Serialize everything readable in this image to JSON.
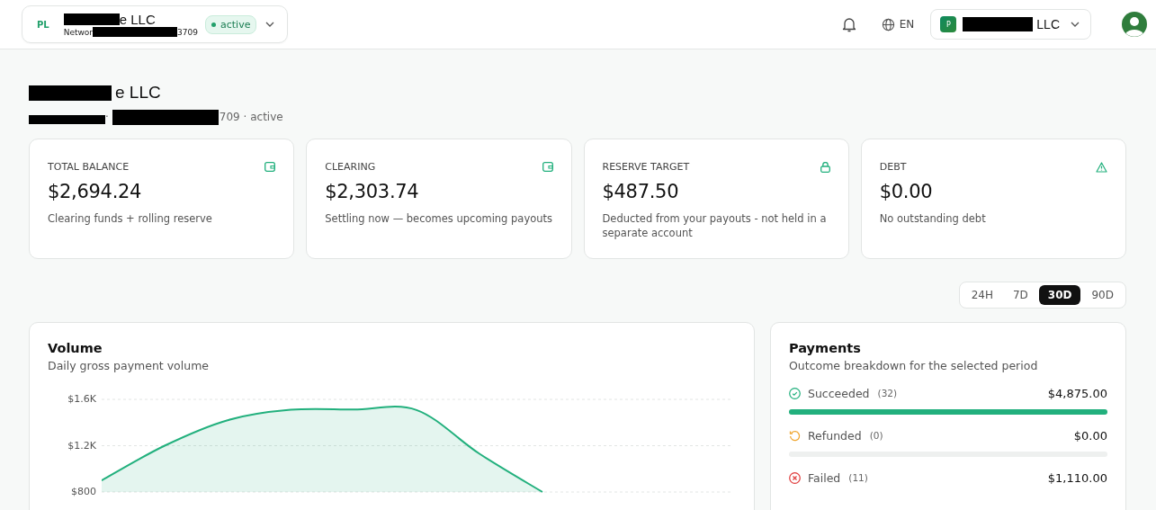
{
  "header": {
    "account_switcher": {
      "initials": "PL",
      "name": [
        {
          "kind": "redaction"
        },
        {
          "kind": "text",
          "text": "e LLC"
        }
      ],
      "network": [
        {
          "kind": "text",
          "text": "Networ"
        },
        {
          "kind": "redaction"
        },
        {
          "kind": "text",
          "text": "3709"
        }
      ],
      "status": "active"
    },
    "language": "EN",
    "merchant_switcher": {
      "initial": "P",
      "name": [
        {
          "kind": "redaction"
        },
        {
          "kind": "text",
          "text": "LLC"
        }
      ]
    }
  },
  "page": {
    "title": [
      {
        "kind": "redaction"
      },
      {
        "kind": "text",
        "text": "e LLC"
      }
    ],
    "subtitle": [
      {
        "kind": "redaction"
      },
      {
        "kind": "text",
        "text": "·"
      },
      {
        "kind": "redaction"
      },
      {
        "kind": "text",
        "text": "709 · active"
      }
    ]
  },
  "stats": [
    {
      "label": "TOTAL BALANCE",
      "value": "$2,694.24",
      "note": "Clearing funds + rolling reserve"
    },
    {
      "label": "CLEARING",
      "value": "$2,303.74",
      "note": "Settling now — becomes upcoming payouts"
    },
    {
      "label": "RESERVE TARGET",
      "value": "$487.50",
      "note": "Deducted from your payouts - not held in a separate account"
    },
    {
      "label": "DEBT",
      "value": "$0.00",
      "note": "No outstanding debt"
    }
  ],
  "periods": [
    {
      "label": "24H",
      "selected": false
    },
    {
      "label": "7D",
      "selected": false
    },
    {
      "label": "30D",
      "selected": true
    },
    {
      "label": "90D",
      "selected": false
    }
  ],
  "volume": {
    "title": "Volume",
    "subtitle": "Daily gross payment volume",
    "chart_data": {
      "type": "area",
      "ylim": [
        800,
        1600
      ],
      "yticks": [
        {
          "value": 800,
          "label": "$800"
        },
        {
          "value": 1200,
          "label": "$1.2K"
        },
        {
          "value": 1600,
          "label": "$1.6K"
        }
      ],
      "series": [
        {
          "color": "#22b07d",
          "values": [
            900,
            1200,
            1420,
            1510,
            1512,
            1508,
            1130,
            800
          ]
        }
      ]
    }
  },
  "payments": {
    "title": "Payments",
    "subtitle": "Outcome breakdown for the selected period",
    "rows": [
      {
        "kind": "succeeded",
        "label": "Succeeded",
        "count": "(32)",
        "amount": "$4,875.00",
        "level": 1
      },
      {
        "kind": "refunded",
        "label": "Refunded",
        "count": "(0)",
        "amount": "$0.00",
        "level": 0
      },
      {
        "kind": "failed",
        "label": "Failed",
        "count": "(11)",
        "amount": "$1,110.00"
      }
    ]
  }
}
